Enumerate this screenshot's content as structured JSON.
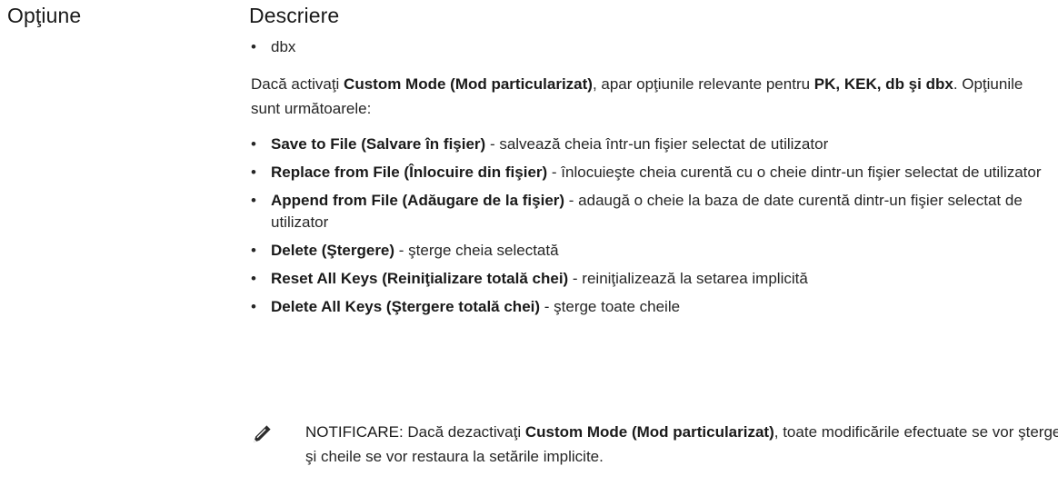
{
  "header": {
    "option": "Opţiune",
    "description": "Descriere"
  },
  "top_bullet": "dbx",
  "intro": {
    "pre": "Dacă activaţi ",
    "custom_mode": "Custom Mode (Mod particularizat)",
    "mid": ", apar opţiunile relevante pentru ",
    "keys": "PK, KEK, db şi dbx",
    "post": ". Opţiunile sunt următoarele:"
  },
  "bullet_char": "•",
  "options": [
    {
      "term": "Save to File (Salvare în fişier)",
      "desc": " - salvează cheia într-un fişier selectat de utilizator"
    },
    {
      "term": "Replace from File (Înlocuire din fişier)",
      "desc": " - înlocuieşte cheia curentă cu o cheie dintr-un fişier selectat de utilizator"
    },
    {
      "term": "Append from File (Adăugare de la fişier)",
      "desc": " - adaugă o cheie la baza de date curentă dintr-un fişier selectat de utilizator"
    },
    {
      "term": "Delete (Ştergere)",
      "desc": " - şterge cheia selectată"
    },
    {
      "term": "Reset All Keys (Reiniţializare totală chei)",
      "desc": " - reiniţializează la setarea implicită"
    },
    {
      "term": "Delete All Keys (Ştergere totală chei)",
      "desc": " - şterge toate cheile"
    }
  ],
  "note": {
    "icon": "pencil-icon",
    "label": "NOTIFICARE:",
    "pre": " Dacă dezactivaţi ",
    "custom_mode": "Custom Mode (Mod particularizat)",
    "post": ", toate modificările efectuate se vor şterge şi cheile se vor restaura la setările implicite."
  }
}
